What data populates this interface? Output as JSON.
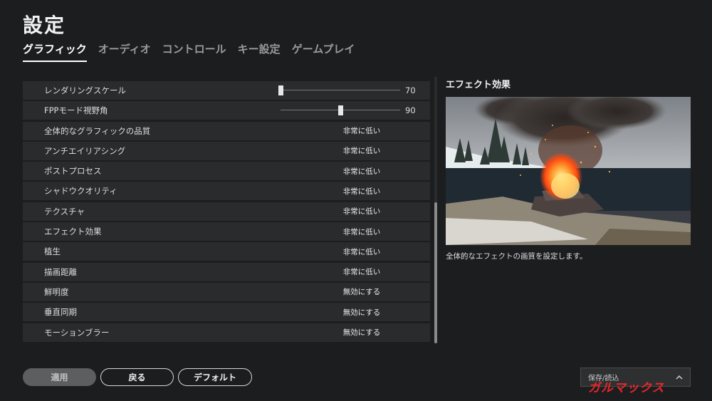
{
  "page_title": "設定",
  "tabs": [
    {
      "label": "グラフィック",
      "active": true
    },
    {
      "label": "オーディオ",
      "active": false
    },
    {
      "label": "コントロール",
      "active": false
    },
    {
      "label": "キー設定",
      "active": false
    },
    {
      "label": "ゲームプレイ",
      "active": false
    }
  ],
  "settings": [
    {
      "label": "レンダリングスケール",
      "type": "slider",
      "value": "70",
      "level": 0.0
    },
    {
      "label": "FPPモード視野角",
      "type": "slider",
      "value": "90",
      "level": 0.5
    },
    {
      "label": "全体的なグラフィックの品質",
      "type": "select",
      "value": "非常に低い"
    },
    {
      "label": "アンチエイリアシング",
      "type": "select",
      "value": "非常に低い"
    },
    {
      "label": "ポストプロセス",
      "type": "select",
      "value": "非常に低い"
    },
    {
      "label": "シャドウクオリティ",
      "type": "select",
      "value": "非常に低い"
    },
    {
      "label": "テクスチャ",
      "type": "select",
      "value": "非常に低い"
    },
    {
      "label": "エフェクト効果",
      "type": "select",
      "value": "非常に低い"
    },
    {
      "label": "植生",
      "type": "select",
      "value": "非常に低い"
    },
    {
      "label": "描画距離",
      "type": "select",
      "value": "非常に低い"
    },
    {
      "label": "鮮明度",
      "type": "select",
      "value": "無効にする"
    },
    {
      "label": "垂直同期",
      "type": "select",
      "value": "無効にする"
    },
    {
      "label": "モーションブラー",
      "type": "select",
      "value": "無効にする"
    }
  ],
  "scrollbar": {
    "thumb_start": 0.47,
    "thumb_end": 1.0
  },
  "preview": {
    "title": "エフェクト効果",
    "description": "全体的なエフェクトの画質を設定します。"
  },
  "buttons": {
    "apply": "適用",
    "back": "戻る",
    "default": "デフォルト"
  },
  "save_load": {
    "label": "保存/読込"
  },
  "watermark": "ガルマックス",
  "colors": {
    "background": "#1c1d1f",
    "row": "#2a2b2d",
    "accent_fire": "#ff6a1a",
    "watermark": "#e8262a"
  }
}
